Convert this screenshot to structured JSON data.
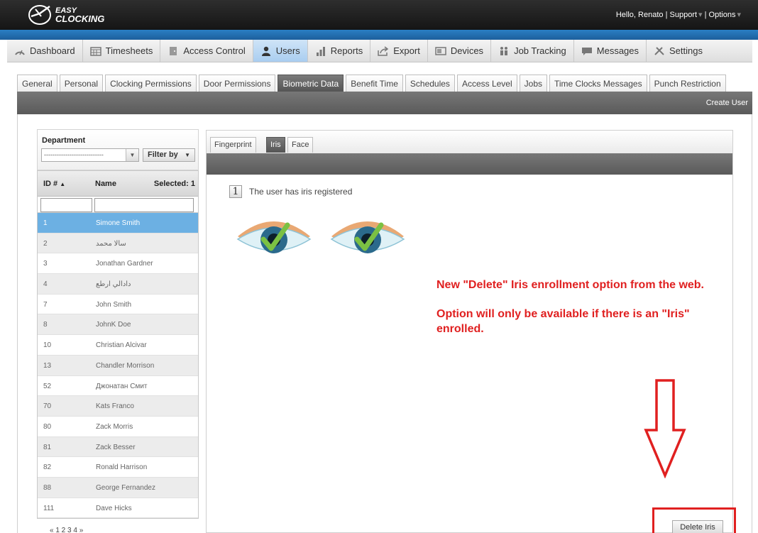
{
  "header": {
    "greeting": "Hello, Renato |",
    "support": "Support",
    "separator": "|",
    "options": "Options"
  },
  "nav": [
    {
      "label": "Dashboard",
      "icon": "dashboard-icon"
    },
    {
      "label": "Timesheets",
      "icon": "calendar-icon"
    },
    {
      "label": "Access Control",
      "icon": "door-icon"
    },
    {
      "label": "Users",
      "icon": "user-icon",
      "active": true
    },
    {
      "label": "Reports",
      "icon": "bar-chart-icon"
    },
    {
      "label": "Export",
      "icon": "export-icon"
    },
    {
      "label": "Devices",
      "icon": "devices-icon"
    },
    {
      "label": "Job Tracking",
      "icon": "job-tracking-icon"
    },
    {
      "label": "Messages",
      "icon": "message-icon"
    },
    {
      "label": "Settings",
      "icon": "wrench-icon"
    }
  ],
  "subtabs": [
    "General",
    "Personal",
    "Clocking Permissions",
    "Door Permissions",
    "Biometric Data",
    "Benefit Time",
    "Schedules",
    "Access Level",
    "Jobs",
    "Time Clocks Messages",
    "Punch Restriction"
  ],
  "active_subtab": "Biometric Data",
  "create_user": "Create User",
  "department": {
    "label": "Department",
    "selected": "----------------------------",
    "filter_label": "Filter by"
  },
  "grid": {
    "col_id": "ID #",
    "col_name": "Name",
    "selected_label": "Selected: 1",
    "rows": [
      {
        "id": "1",
        "name": "Simone Smith",
        "selected": true
      },
      {
        "id": "2",
        "name": "سالا محمد"
      },
      {
        "id": "3",
        "name": "Jonathan Gardner"
      },
      {
        "id": "4",
        "name": "دادالي ارطع"
      },
      {
        "id": "7",
        "name": "John Smith"
      },
      {
        "id": "8",
        "name": "JohnK Doe"
      },
      {
        "id": "10",
        "name": "Christian Alcivar"
      },
      {
        "id": "13",
        "name": "Chandler Morrison"
      },
      {
        "id": "52",
        "name": "Джонатан Смит"
      },
      {
        "id": "70",
        "name": "Kats Franco"
      },
      {
        "id": "80",
        "name": "Zack Morris"
      },
      {
        "id": "81",
        "name": "Zack Besser"
      },
      {
        "id": "82",
        "name": "Ronald Harrison"
      },
      {
        "id": "88",
        "name": "George Fernandez"
      },
      {
        "id": "111",
        "name": "Dave Hicks"
      }
    ],
    "pager": "« 1 2 3 4 »"
  },
  "bio_tabs": [
    "Fingerprint",
    "Iris",
    "Face"
  ],
  "active_bio_tab": "Iris",
  "iris": {
    "badge": "1",
    "status": "The user has iris registered"
  },
  "annotation": {
    "line1": "New \"Delete\" Iris enrollment option from the web.",
    "line2": "Option will only be available if there is an \"Iris\" enrolled.",
    "color": "#e02020"
  },
  "delete_button": "Delete Iris",
  "colors": {
    "accent_blue": "#2a7fc4",
    "selected_row": "#6cb0e3",
    "dark_bar": "#5a5a5a"
  }
}
